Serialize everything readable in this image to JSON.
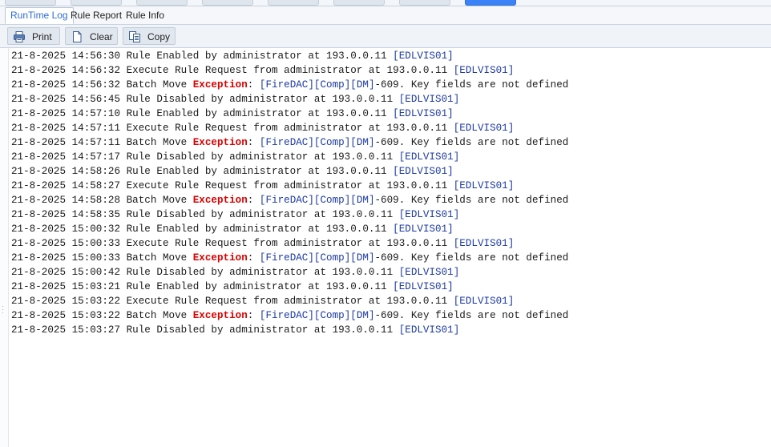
{
  "tabs": [
    {
      "label": "RunTime Log",
      "active": true
    },
    {
      "label": "Rule Report",
      "active": false
    },
    {
      "label": "Rule Info",
      "active": false
    }
  ],
  "toolbar": {
    "print_label": "Print",
    "clear_label": "Clear",
    "copy_label": "Copy"
  },
  "log": [
    {
      "ts": "21-8-2025 14:56:30",
      "msg": "Rule Enabled by administrator at 193.0.0.11",
      "src": "[EDLVIS01]"
    },
    {
      "ts": "21-8-2025 14:56:32",
      "msg": "Execute Rule Request from administrator at 193.0.0.11",
      "src": "[EDLVIS01]"
    },
    {
      "ts": "21-8-2025 14:56:32",
      "pre": "Batch Move",
      "exc": "Exception",
      "post": ":",
      "src": "[FireDAC][Comp][DM]",
      "tail": "-609. Key fields are not defined"
    },
    {
      "ts": "21-8-2025 14:56:45",
      "msg": "Rule Disabled by administrator at 193.0.0.11",
      "src": "[EDLVIS01]"
    },
    {
      "ts": "21-8-2025 14:57:10",
      "msg": "Rule Enabled by administrator at 193.0.0.11",
      "src": "[EDLVIS01]"
    },
    {
      "ts": "21-8-2025 14:57:11",
      "msg": "Execute Rule Request from administrator at 193.0.0.11",
      "src": "[EDLVIS01]"
    },
    {
      "ts": "21-8-2025 14:57:11",
      "pre": "Batch Move",
      "exc": "Exception",
      "post": ":",
      "src": "[FireDAC][Comp][DM]",
      "tail": "-609. Key fields are not defined"
    },
    {
      "ts": "21-8-2025 14:57:17",
      "msg": "Rule Disabled by administrator at 193.0.0.11",
      "src": "[EDLVIS01]"
    },
    {
      "ts": "21-8-2025 14:58:26",
      "msg": "Rule Enabled by administrator at 193.0.0.11",
      "src": "[EDLVIS01]"
    },
    {
      "ts": "21-8-2025 14:58:27",
      "msg": "Execute Rule Request from administrator at 193.0.0.11",
      "src": "[EDLVIS01]"
    },
    {
      "ts": "21-8-2025 14:58:28",
      "pre": "Batch Move",
      "exc": "Exception",
      "post": ":",
      "src": "[FireDAC][Comp][DM]",
      "tail": "-609. Key fields are not defined"
    },
    {
      "ts": "21-8-2025 14:58:35",
      "msg": "Rule Disabled by administrator at 193.0.0.11",
      "src": "[EDLVIS01]"
    },
    {
      "ts": "21-8-2025 15:00:32",
      "msg": "Rule Enabled by administrator at 193.0.0.11",
      "src": "[EDLVIS01]"
    },
    {
      "ts": "21-8-2025 15:00:33",
      "msg": "Execute Rule Request from administrator at 193.0.0.11",
      "src": "[EDLVIS01]"
    },
    {
      "ts": "21-8-2025 15:00:33",
      "pre": "Batch Move",
      "exc": "Exception",
      "post": ":",
      "src": "[FireDAC][Comp][DM]",
      "tail": "-609. Key fields are not defined"
    },
    {
      "ts": "21-8-2025 15:00:42",
      "msg": "Rule Disabled by administrator at 193.0.0.11",
      "src": "[EDLVIS01]"
    },
    {
      "ts": "21-8-2025 15:03:21",
      "msg": "Rule Enabled by administrator at 193.0.0.11",
      "src": "[EDLVIS01]"
    },
    {
      "ts": "21-8-2025 15:03:22",
      "msg": "Execute Rule Request from administrator at 193.0.0.11",
      "src": "[EDLVIS01]"
    },
    {
      "ts": "21-8-2025 15:03:22",
      "pre": "Batch Move",
      "exc": "Exception",
      "post": ":",
      "src": "[FireDAC][Comp][DM]",
      "tail": "-609. Key fields are not defined"
    },
    {
      "ts": "21-8-2025 15:03:27",
      "msg": "Rule Disabled by administrator at 193.0.0.11",
      "src": "[EDLVIS01]"
    }
  ],
  "colors": {
    "accent": "#3b82f6",
    "active_tab_text": "#2f6bd6",
    "exception": "#d80000",
    "source_tag": "#1d3aa0"
  },
  "icons": {
    "print": "printer-icon",
    "clear": "blank-document-icon",
    "copy": "copy-icon"
  }
}
